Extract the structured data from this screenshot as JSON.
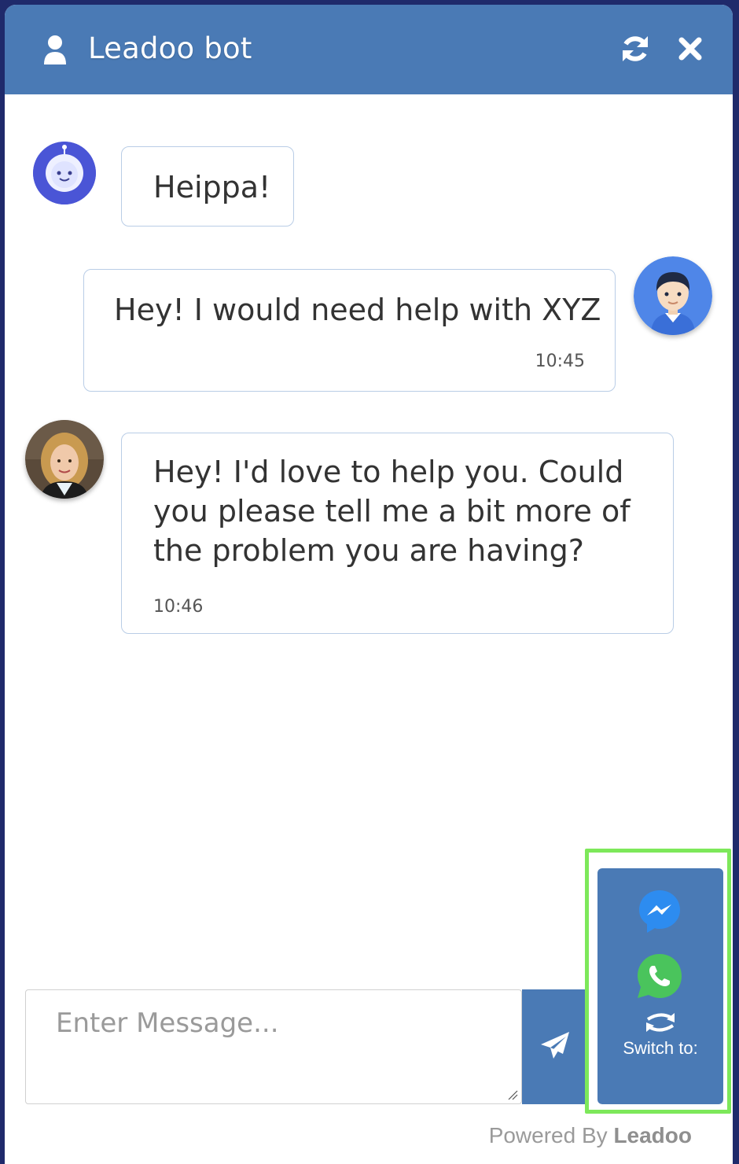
{
  "header": {
    "title": "Leadoo bot",
    "icons": {
      "user": "user-icon",
      "refresh": "refresh-icon",
      "close": "close-icon"
    },
    "background": "#4a7ab5"
  },
  "messages": [
    {
      "sender": "bot",
      "avatar": "bot-avatar-icon",
      "text": "Heippa!",
      "time": ""
    },
    {
      "sender": "user",
      "avatar": "user-avatar",
      "text": "Hey! I would need help with XYZ",
      "time": "10:45"
    },
    {
      "sender": "agent",
      "avatar": "agent-avatar",
      "text": "Hey! I'd love to help you. Could you please tell me a bit more of the problem you are having?",
      "time": "10:46"
    }
  ],
  "composer": {
    "placeholder": "Enter Message...",
    "value": "",
    "send_icon": "paper-plane-icon"
  },
  "switch_panel": {
    "label": "Switch to:",
    "options": [
      "messenger-icon",
      "whatsapp-icon"
    ],
    "highlight_color": "#7de85a"
  },
  "footer": {
    "powered_by": "Powered By",
    "brand": "Leadoo"
  }
}
